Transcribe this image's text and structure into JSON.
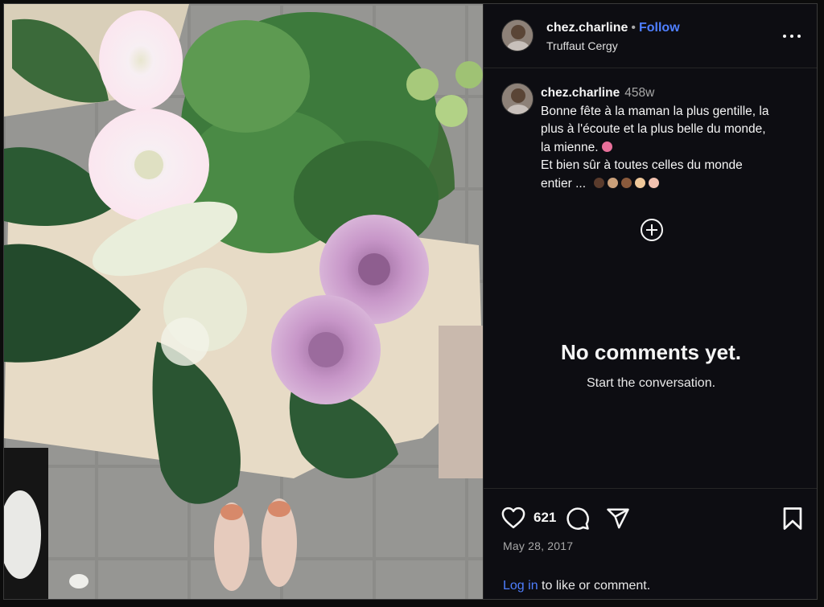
{
  "post": {
    "username": "chez.charline",
    "follow_label": "Follow",
    "dot": "•",
    "location": "Truffaut Cergy"
  },
  "caption": {
    "username": "chez.charline",
    "time_ago": "458w",
    "lines": [
      "Bonne fête à la maman la plus gentille, la",
      "plus à l'écoute et la plus belle du monde,",
      "la mienne.",
      "Et bien sûr à toutes celles du monde",
      "entier ..."
    ],
    "emojis": [
      "#e8709a",
      "#5a3b2c",
      "#caa07a",
      "#8a5a3c",
      "#f0c89a",
      "#f2c2b0"
    ]
  },
  "comments": {
    "empty_title": "No comments yet.",
    "empty_subtitle": "Start the conversation."
  },
  "actions": {
    "like_count": "621",
    "date": "May 28, 2017",
    "login_link": "Log in",
    "login_suffix": " to like or comment."
  },
  "icons": {
    "more": "more-options-icon",
    "add_comment": "plus-circle-icon",
    "like": "heart-icon",
    "comment": "comment-bubble-icon",
    "share": "send-icon",
    "save": "bookmark-icon"
  }
}
